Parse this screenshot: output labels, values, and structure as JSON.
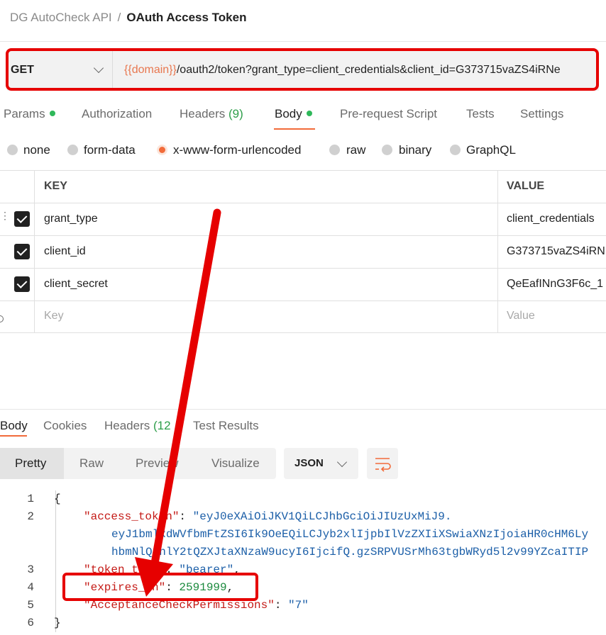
{
  "breadcrumb": {
    "collection": "DG AutoCheck API",
    "separator": "/",
    "request": "OAuth Access Token"
  },
  "request": {
    "method": "GET",
    "url_variable": "{{domain}}",
    "url_rest": "/oauth2/token?grant_type=client_credentials&client_id=G373715vaZS4iRNe"
  },
  "tabs": [
    {
      "label": "Params",
      "dot": true
    },
    {
      "label": "Authorization"
    },
    {
      "label": "Headers",
      "count": "(9)"
    },
    {
      "label": "Body",
      "dot": true,
      "active": true
    },
    {
      "label": "Pre-request Script"
    },
    {
      "label": "Tests"
    },
    {
      "label": "Settings"
    }
  ],
  "body_types": [
    "none",
    "form-data",
    "x-www-form-urlencoded",
    "raw",
    "binary",
    "GraphQL"
  ],
  "body_type_selected": "x-www-form-urlencoded",
  "table": {
    "headers": {
      "key": "KEY",
      "value": "VALUE"
    },
    "rows": [
      {
        "key": "grant_type",
        "value": "client_credentials",
        "checked": true
      },
      {
        "key": "client_id",
        "value": "G373715vaZS4iRN",
        "checked": true
      },
      {
        "key": "client_secret",
        "value": "QeEafINnG3F6c_1",
        "checked": true
      }
    ],
    "placeholder": {
      "key": "Key",
      "value": "Value"
    }
  },
  "response": {
    "tabs": [
      {
        "label": "Body",
        "active": true
      },
      {
        "label": "Cookies"
      },
      {
        "label": "Headers",
        "count": "(12"
      },
      {
        "label": "Test Results"
      }
    ],
    "view_modes": [
      "Pretty",
      "Raw",
      "Preview",
      "Visualize"
    ],
    "format": "JSON",
    "lines": {
      "l1": "1",
      "l2": "2",
      "l3": "3",
      "l4": "4",
      "l5": "5",
      "l6": "6",
      "open_brace": "{",
      "close_brace": "}",
      "k_access": "\"access_token\"",
      "v_access_1": "\"eyJ0eXAiOiJKV1QiLCJhbGciOiJIUzUxMiJ9.",
      "v_access_2": "eyJ1bmlxdWVfbmFtZSI6Ik9OeEQiLCJyb2xlIjpbIlVzZXIiXSwiaXNzIjoiaHR0cHM6Ly",
      "v_access_3": "hbmNlQ2hlY2tQZXJtaXNzaW9ucyI6IjcifQ.gzSRPVUSrMh63tgbWRyd5l2v99YZcaITIP",
      "k_type": "\"token_type\"",
      "v_type": "\"bearer\"",
      "k_expires": "\"expires_in\"",
      "v_expires": "2591999",
      "k_perm": "\"AcceptanceCheckPermissions\"",
      "v_perm": "\"7\""
    }
  },
  "colors": {
    "annotation_red": "#e60000",
    "accent_orange": "#f26b3a",
    "status_green": "#2fb85a"
  },
  "icons": {
    "method_dropdown": "chevron-down-icon",
    "format_dropdown": "chevron-down-icon",
    "wrap": "wrap-lines-icon",
    "drag": "drag-handle-icon",
    "check": "checkbox-checked-icon"
  }
}
